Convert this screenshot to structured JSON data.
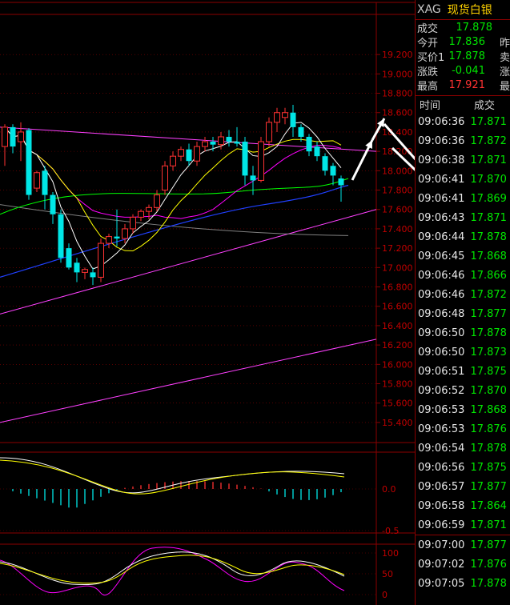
{
  "chart_data": [
    {
      "type": "candlestick",
      "ylim": [
        15.3,
        19.35
      ],
      "y_ticks": [
        "19.200",
        "19.000",
        "18.800",
        "18.600",
        "18.400",
        "18.200",
        "18.000",
        "17.800",
        "17.600",
        "17.400",
        "17.200",
        "17.000",
        "16.800",
        "16.600",
        "16.400",
        "16.200",
        "16.000",
        "15.800",
        "15.600",
        "15.400"
      ],
      "candles": [
        {
          "o": 18.25,
          "h": 18.48,
          "l": 18.05,
          "c": 18.45
        },
        {
          "o": 18.45,
          "h": 18.48,
          "l": 18.18,
          "c": 18.25
        },
        {
          "o": 18.3,
          "h": 18.5,
          "l": 18.1,
          "c": 18.4
        },
        {
          "o": 18.42,
          "h": 18.44,
          "l": 17.7,
          "c": 17.75
        },
        {
          "o": 17.82,
          "h": 18.0,
          "l": 17.78,
          "c": 17.98
        },
        {
          "o": 18.0,
          "h": 18.05,
          "l": 17.6,
          "c": 17.75
        },
        {
          "o": 17.75,
          "h": 17.78,
          "l": 17.45,
          "c": 17.55
        },
        {
          "o": 17.55,
          "h": 17.6,
          "l": 17.05,
          "c": 17.1
        },
        {
          "o": 17.2,
          "h": 17.25,
          "l": 16.98,
          "c": 17.0
        },
        {
          "o": 17.05,
          "h": 17.1,
          "l": 16.85,
          "c": 16.95
        },
        {
          "o": 16.95,
          "h": 17.0,
          "l": 16.88,
          "c": 16.98
        },
        {
          "o": 16.95,
          "h": 17.0,
          "l": 16.82,
          "c": 16.9
        },
        {
          "o": 16.9,
          "h": 17.3,
          "l": 16.85,
          "c": 17.25
        },
        {
          "o": 17.25,
          "h": 17.35,
          "l": 17.2,
          "c": 17.32
        },
        {
          "o": 17.32,
          "h": 17.6,
          "l": 17.22,
          "c": 17.3
        },
        {
          "o": 17.3,
          "h": 17.45,
          "l": 17.25,
          "c": 17.4
        },
        {
          "o": 17.4,
          "h": 17.55,
          "l": 17.35,
          "c": 17.52
        },
        {
          "o": 17.52,
          "h": 17.6,
          "l": 17.48,
          "c": 17.58
        },
        {
          "o": 17.58,
          "h": 17.65,
          "l": 17.5,
          "c": 17.62
        },
        {
          "o": 17.62,
          "h": 17.8,
          "l": 17.58,
          "c": 17.75
        },
        {
          "o": 17.8,
          "h": 18.1,
          "l": 17.75,
          "c": 18.05
        },
        {
          "o": 18.05,
          "h": 18.2,
          "l": 18.0,
          "c": 18.15
        },
        {
          "o": 18.15,
          "h": 18.25,
          "l": 18.1,
          "c": 18.22
        },
        {
          "o": 18.22,
          "h": 18.28,
          "l": 18.05,
          "c": 18.1
        },
        {
          "o": 18.1,
          "h": 18.3,
          "l": 18.05,
          "c": 18.25
        },
        {
          "o": 18.25,
          "h": 18.35,
          "l": 18.2,
          "c": 18.3
        },
        {
          "o": 18.3,
          "h": 18.35,
          "l": 18.2,
          "c": 18.27
        },
        {
          "o": 18.27,
          "h": 18.4,
          "l": 18.22,
          "c": 18.35
        },
        {
          "o": 18.35,
          "h": 18.42,
          "l": 18.25,
          "c": 18.3
        },
        {
          "o": 18.3,
          "h": 18.45,
          "l": 18.25,
          "c": 18.28
        },
        {
          "o": 18.3,
          "h": 18.35,
          "l": 17.85,
          "c": 17.95
        },
        {
          "o": 17.95,
          "h": 18.05,
          "l": 17.75,
          "c": 17.9
        },
        {
          "o": 17.9,
          "h": 18.35,
          "l": 17.88,
          "c": 18.3
        },
        {
          "o": 18.3,
          "h": 18.55,
          "l": 18.25,
          "c": 18.5
        },
        {
          "o": 18.5,
          "h": 18.65,
          "l": 18.4,
          "c": 18.6
        },
        {
          "o": 18.55,
          "h": 18.65,
          "l": 18.48,
          "c": 18.6
        },
        {
          "o": 18.6,
          "h": 18.68,
          "l": 18.35,
          "c": 18.45
        },
        {
          "o": 18.45,
          "h": 18.48,
          "l": 18.3,
          "c": 18.35
        },
        {
          "o": 18.35,
          "h": 18.38,
          "l": 18.15,
          "c": 18.2
        },
        {
          "o": 18.25,
          "h": 18.3,
          "l": 18.1,
          "c": 18.15
        },
        {
          "o": 18.15,
          "h": 18.18,
          "l": 17.95,
          "c": 18.0
        },
        {
          "o": 18.05,
          "h": 18.08,
          "l": 17.85,
          "c": 17.95
        },
        {
          "o": 17.92,
          "h": 17.95,
          "l": 17.68,
          "c": 17.85
        }
      ],
      "colors": {
        "bull": "#ff3232",
        "bear": "#00e6e6",
        "ma5": "#ffffff",
        "ma10": "#ffff00",
        "ma20": "#ff00ff",
        "ma60": "#00ff00",
        "ma120": "#2040ff",
        "ma250": "#808080",
        "trend": "#ff40ff"
      }
    },
    {
      "type": "macd",
      "y_ticks": [
        "0.0",
        "-0.5"
      ]
    },
    {
      "type": "kdj",
      "y_ticks": [
        "100",
        "50",
        "0"
      ]
    }
  ],
  "quote": {
    "symbol": "XAG",
    "name": "现货白银",
    "rows": [
      {
        "label": "成交",
        "value": "17.878",
        "extra": "",
        "cls": "down"
      },
      {
        "label": "今开",
        "value": "17.836",
        "extra": "昨",
        "cls": "down"
      },
      {
        "label": "买价1",
        "value": "17.878",
        "extra": "卖",
        "cls": "down"
      },
      {
        "label": "涨跌",
        "value": "-0.041",
        "extra": "涨",
        "cls": "down"
      },
      {
        "label": "最高",
        "value": "17.921",
        "extra": "最",
        "cls": "up"
      }
    ]
  },
  "ticks_header": {
    "time": "时间",
    "price": "成交"
  },
  "ticks": [
    {
      "time": "09:06:36",
      "price": "17.871"
    },
    {
      "time": "09:06:36",
      "price": "17.872"
    },
    {
      "time": "09:06:38",
      "price": "17.871"
    },
    {
      "time": "09:06:41",
      "price": "17.870"
    },
    {
      "time": "09:06:41",
      "price": "17.869"
    },
    {
      "time": "09:06:43",
      "price": "17.871"
    },
    {
      "time": "09:06:44",
      "price": "17.878"
    },
    {
      "time": "09:06:45",
      "price": "17.868"
    },
    {
      "time": "09:06:46",
      "price": "17.866"
    },
    {
      "time": "09:06:46",
      "price": "17.872"
    },
    {
      "time": "09:06:48",
      "price": "17.877"
    },
    {
      "time": "09:06:50",
      "price": "17.878"
    },
    {
      "time": "09:06:50",
      "price": "17.873"
    },
    {
      "time": "09:06:51",
      "price": "17.875"
    },
    {
      "time": "09:06:52",
      "price": "17.870"
    },
    {
      "time": "09:06:53",
      "price": "17.868"
    },
    {
      "time": "09:06:53",
      "price": "17.876"
    },
    {
      "time": "09:06:54",
      "price": "17.878"
    },
    {
      "time": "09:06:56",
      "price": "17.875"
    },
    {
      "time": "09:06:57",
      "price": "17.877"
    },
    {
      "time": "09:06:58",
      "price": "17.864"
    },
    {
      "time": "09:06:59",
      "price": "17.871"
    },
    {
      "time": "09:07:00",
      "price": "17.877"
    },
    {
      "time": "09:07:02",
      "price": "17.876"
    },
    {
      "time": "09:07:05",
      "price": "17.878"
    }
  ]
}
